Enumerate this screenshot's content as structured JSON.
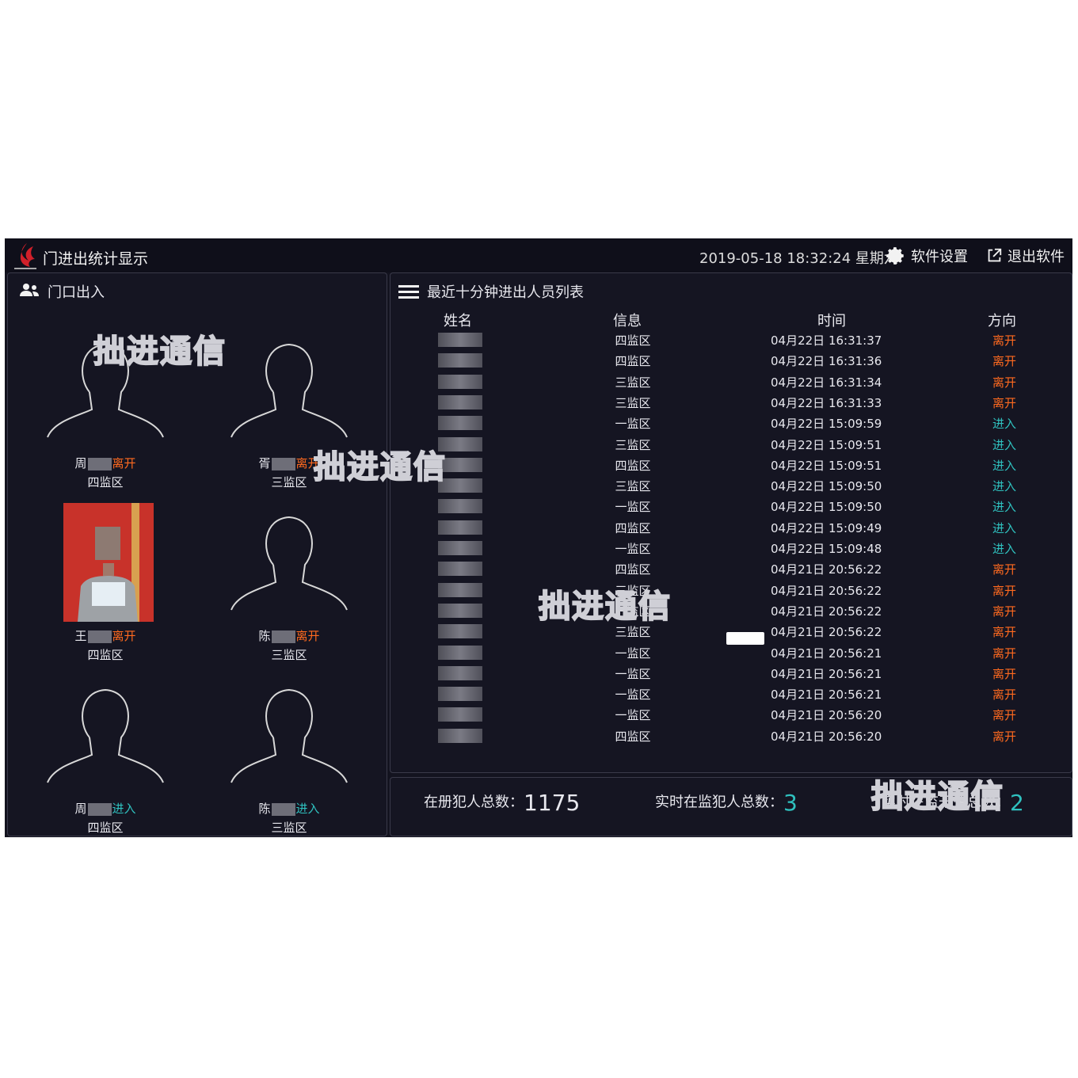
{
  "header": {
    "title": "门进出统计显示",
    "datetime": "2019-05-18 18:32:24 星期六",
    "settings_label": "软件设置",
    "exit_label": "退出软件"
  },
  "door_panel": {
    "title": "门口出入",
    "cards": [
      {
        "name_a": "周",
        "name_b": "",
        "direction": "离开",
        "zone": "四监区"
      },
      {
        "name_a": "胥",
        "name_b": "",
        "direction": "离开",
        "zone": "三监区"
      },
      {
        "name_a": "王",
        "name_b": "",
        "direction": "离开",
        "zone": "四监区"
      },
      {
        "name_a": "陈",
        "name_b": "",
        "direction": "离开",
        "zone": "三监区"
      },
      {
        "name_a": "周",
        "name_b": "",
        "direction": "进入",
        "zone": "四监区"
      },
      {
        "name_a": "陈",
        "name_b": "",
        "direction": "进入",
        "zone": "三监区"
      }
    ]
  },
  "list_panel": {
    "title": "最近十分钟进出人员列表",
    "columns": [
      "姓名",
      "信息",
      "时间",
      "方向"
    ],
    "rows": [
      {
        "info": "四监区",
        "time": "04月22日 16:31:37",
        "dir": "离开"
      },
      {
        "info": "四监区",
        "time": "04月22日 16:31:36",
        "dir": "离开"
      },
      {
        "info": "三监区",
        "time": "04月22日 16:31:34",
        "dir": "离开"
      },
      {
        "info": "三监区",
        "time": "04月22日 16:31:33",
        "dir": "离开"
      },
      {
        "info": "一监区",
        "time": "04月22日 15:09:59",
        "dir": "进入"
      },
      {
        "info": "三监区",
        "time": "04月22日 15:09:51",
        "dir": "进入"
      },
      {
        "info": "四监区",
        "time": "04月22日 15:09:51",
        "dir": "进入"
      },
      {
        "info": "三监区",
        "time": "04月22日 15:09:50",
        "dir": "进入"
      },
      {
        "info": "一监区",
        "time": "04月22日 15:09:50",
        "dir": "进入"
      },
      {
        "info": "四监区",
        "time": "04月22日 15:09:49",
        "dir": "进入"
      },
      {
        "info": "一监区",
        "time": "04月22日 15:09:48",
        "dir": "进入"
      },
      {
        "info": "四监区",
        "time": "04月21日 20:56:22",
        "dir": "离开"
      },
      {
        "info": "三监区",
        "time": "04月21日 20:56:22",
        "dir": "离开"
      },
      {
        "info": "一监区",
        "time": "04月21日 20:56:22",
        "dir": "离开"
      },
      {
        "info": "三监区",
        "time": "04月21日 20:56:22",
        "dir": "离开"
      },
      {
        "info": "一监区",
        "time": "04月21日 20:56:21",
        "dir": "离开"
      },
      {
        "info": "一监区",
        "time": "04月21日 20:56:21",
        "dir": "离开"
      },
      {
        "info": "一监区",
        "time": "04月21日 20:56:21",
        "dir": "离开"
      },
      {
        "info": "一监区",
        "time": "04月21日 20:56:20",
        "dir": "离开"
      },
      {
        "info": "四监区",
        "time": "04月21日 20:56:20",
        "dir": "离开"
      }
    ]
  },
  "stats": {
    "registered_label": "在册犯人总数：",
    "registered_value": "1175",
    "present_label": "实时在监犯人总数：",
    "present_value": "3",
    "police_label": "实时在监干警总数：",
    "police_value": "2"
  },
  "watermark": "拙进通信",
  "colors": {
    "leave": "#ff6a1f",
    "enter": "#2fc1bf",
    "background": "#13131f"
  }
}
